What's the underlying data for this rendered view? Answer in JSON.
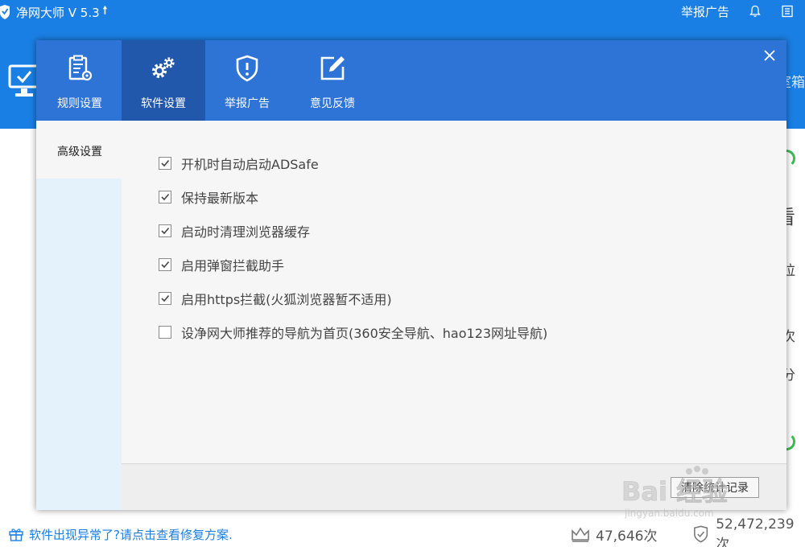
{
  "app": {
    "title": "净网大师 V 5.3",
    "report_link": "举报广告",
    "edge_text": "室箱",
    "fragments": [
      "看",
      "拉",
      "次",
      "分"
    ]
  },
  "dialog": {
    "tabs": [
      {
        "label": "规则设置",
        "icon": "clipboard-gear-icon"
      },
      {
        "label": "软件设置",
        "icon": "gears-icon",
        "active": true
      },
      {
        "label": "举报广告",
        "icon": "shield-alert-icon"
      },
      {
        "label": "意见反馈",
        "icon": "edit-icon"
      }
    ],
    "sidebar": {
      "items": [
        {
          "label": "高级设置"
        }
      ]
    },
    "options": [
      {
        "label": "开机时自动启动ADSafe",
        "checked": true
      },
      {
        "label": "保持最新版本",
        "checked": true
      },
      {
        "label": "启动时清理浏览器缓存",
        "checked": true
      },
      {
        "label": "启用弹窗拦截助手",
        "checked": true
      },
      {
        "label": "启用https拦截(火狐浏览器暂不适用)",
        "checked": true
      },
      {
        "label": "设净网大师推荐的导航为首页(360安全导航、hao123网址导航)",
        "checked": false
      }
    ],
    "clear_button": "清除统计记录"
  },
  "footer": {
    "help_link": "软件出现异常了?请点击查看修复方案.",
    "stat_1": "47,646次",
    "stat_2": "52,472,239次"
  },
  "watermark": {
    "text": "Bai 经验",
    "url": "jingyan.baidu.com"
  },
  "colors": {
    "brand_blue": "#1a7fe4",
    "dialog_header": "#2e73d6",
    "active_tab": "#2258ab",
    "sidebar_bg": "#e4f2fc",
    "status_green": "#3cba55"
  }
}
